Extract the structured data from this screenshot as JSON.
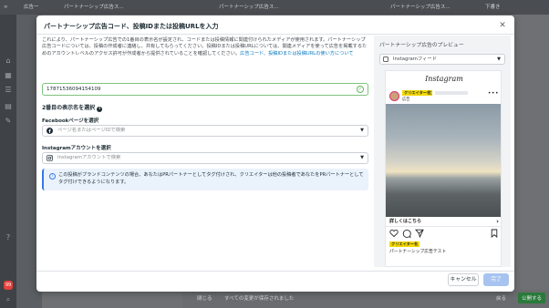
{
  "background": {
    "tabs": [
      "広告ー",
      "パートナーシップ広告ス...",
      "パートナーシップ広告ス...",
      "パートナーシップ広告ス..."
    ],
    "topbar_right": "下書き",
    "bottom_close": "閉じる",
    "bottom_saved": "すべての変更が保存されました",
    "bottom_back": "戻る",
    "bottom_publish": "公開する",
    "notification_count": "99"
  },
  "modal": {
    "title": "パートナーシップ広告コード、投稿IDまたは投稿URLを入力",
    "description_main": "これにより、パートナーシップ広告での1番目の表示名が設定され、コードまたは投稿情報に関連付けられたメディアが使用されます。パートナーシップ広告コードについては、投稿の作成者に連絡し、共有してもらってください。投稿IDまたは投稿URLについては、関連メディアを使って広告を掲載するためのアカウントレベルのアクセス許可が作成者から提供されていることを確認してください。",
    "description_link": "広告コード、投稿IDまたは投稿URLの使い方について",
    "code_value": "17871536094154109",
    "second_name_title": "2番目の表示名を選択",
    "facebook_label": "Facebookページを選択",
    "facebook_placeholder": "ページ名またはページIDで検索",
    "instagram_label": "Instagramアカウントを選択",
    "instagram_placeholder": "Instagramアカウントで検索",
    "info_text": "この投稿がブランドコンテンツの場合、あなたはPRパートナーとしてタグ付けされ、クリエイターは他の投稿者であなたをPRパートナーとしてタグ付けできるようになります。",
    "cancel_label": "キャンセル",
    "done_label": "完了"
  },
  "preview": {
    "title": "パートナーシップ広告のプレビュー",
    "placement": "Instagramフィード",
    "ig_logo": "Instagram",
    "creator_badge": "クリエイター名",
    "ampersand": "と",
    "sponsored": "広告",
    "cta": "詳しくはこちら",
    "caption_badge": "クリエイター名",
    "caption": "パートナーシップ広告テスト"
  },
  "colors": {
    "accent": "#0a78be",
    "info_bg": "#eaf3fc",
    "done_btn": "#a7c4f0",
    "creator_badge": "#f5d800"
  }
}
